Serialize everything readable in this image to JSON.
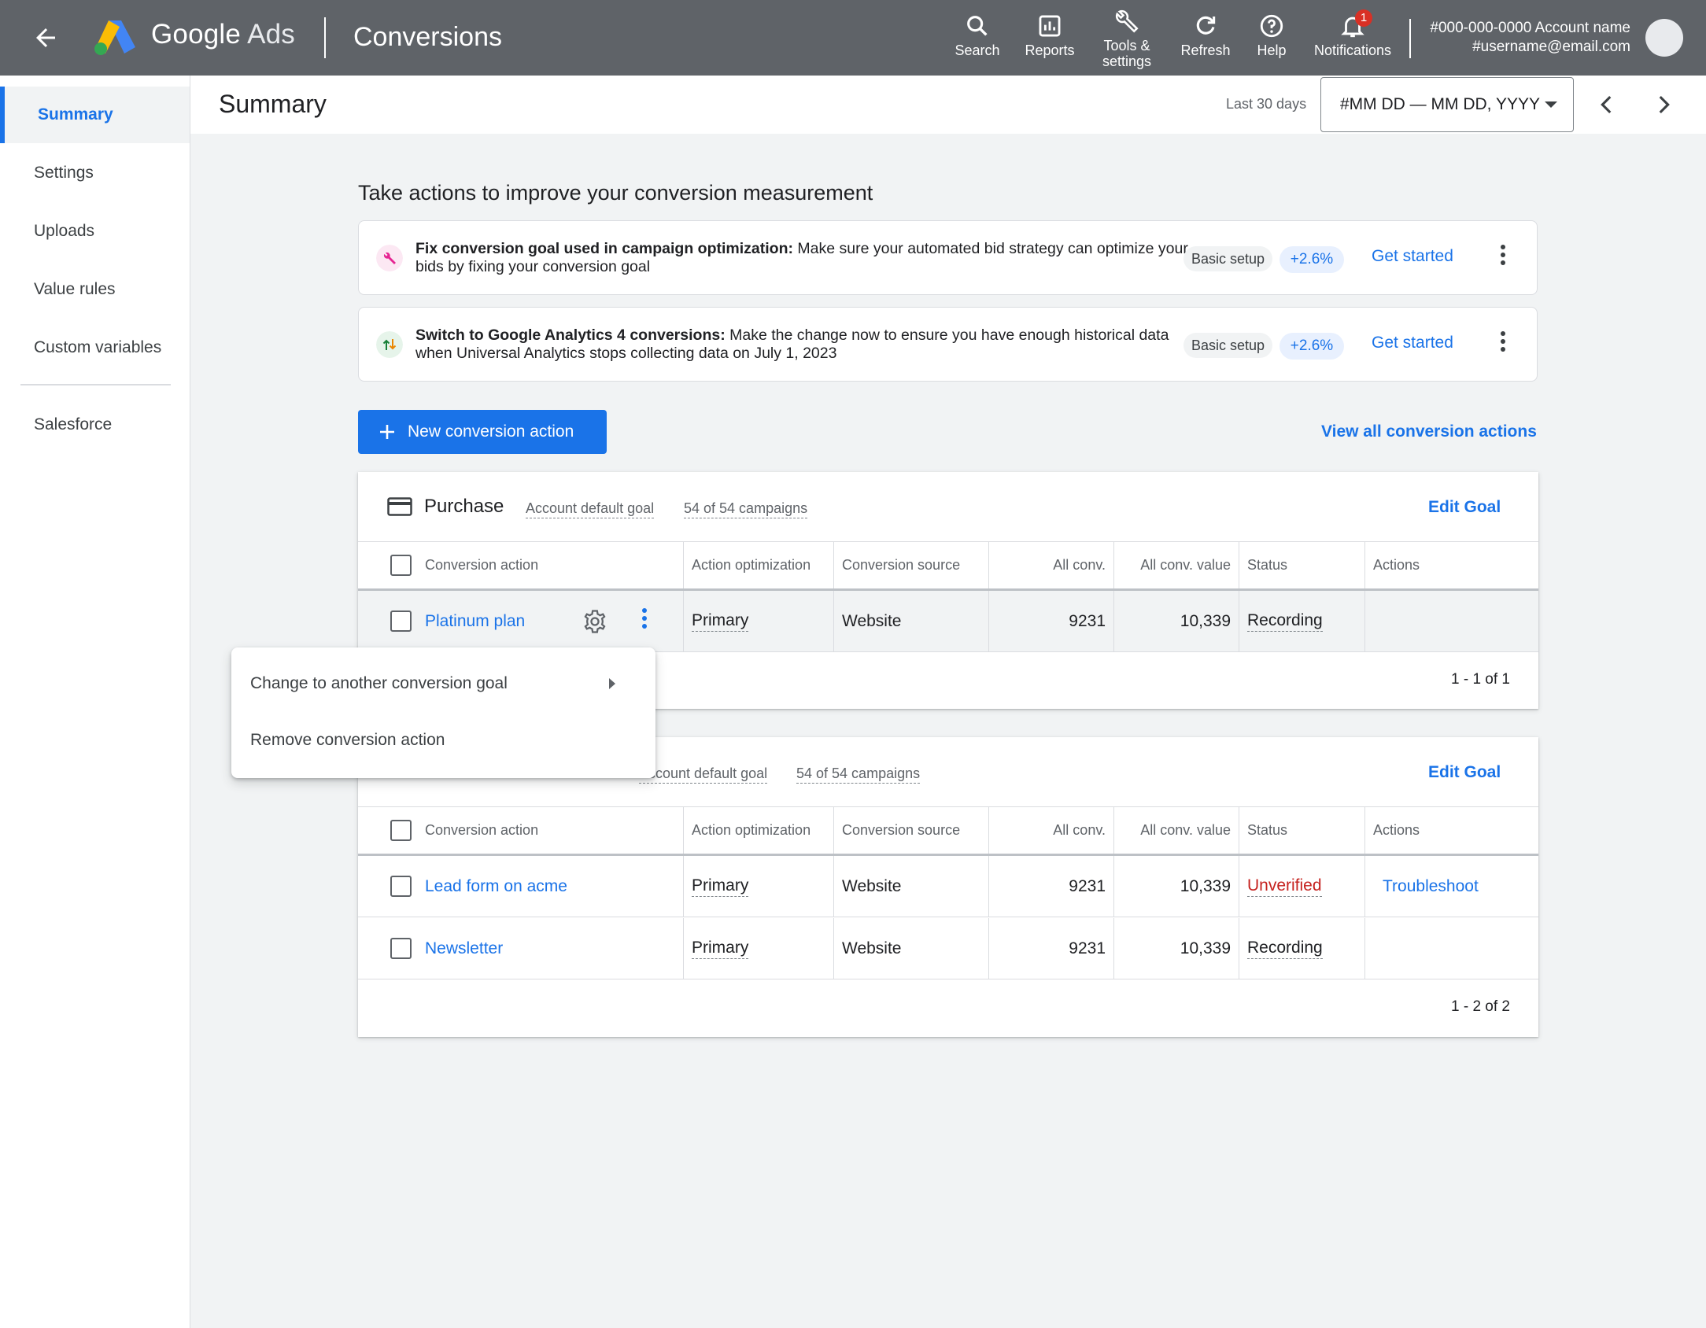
{
  "topbar": {
    "brand_google": "Google",
    "brand_ads": "Ads",
    "section": "Conversions",
    "items": [
      {
        "label": "Search",
        "icon": "search-icon"
      },
      {
        "label": "Reports",
        "icon": "reports-icon"
      },
      {
        "label": "Tools &",
        "label2": "settings",
        "icon": "wrench-icon"
      },
      {
        "label": "Refresh",
        "icon": "refresh-icon"
      },
      {
        "label": "Help",
        "icon": "help-icon"
      },
      {
        "label": "Notifications",
        "icon": "bell-icon",
        "badge": "1"
      }
    ],
    "account_line1": "#000-000-0000 Account name",
    "account_line2": "#username@email.com"
  },
  "sidebar": {
    "items": [
      {
        "label": "Summary",
        "active": true
      },
      {
        "label": "Settings"
      },
      {
        "label": "Uploads"
      },
      {
        "label": "Value rules"
      },
      {
        "label": "Custom variables"
      },
      {
        "label": "Salesforce"
      }
    ]
  },
  "subheader": {
    "title": "Summary",
    "range_label": "Last 30 days",
    "date_range": "#MM DD — MM DD, YYYY"
  },
  "recommendations": {
    "title": "Take actions to improve your conversion measurement",
    "cards": [
      {
        "bold": "Fix conversion goal used in campaign optimization:",
        "text": " Make sure your automated bid strategy can optimize your bids by fixing your conversion goal",
        "chip": "Basic setup",
        "uplift": "+2.6%",
        "cta": "Get started",
        "icon": "wrench-icon"
      },
      {
        "bold": "Switch to Google Analytics 4 conversions:",
        "text": " Make the change now to ensure you have enough historical data when Universal Analytics stops collecting data on July 1, 2023",
        "chip": "Basic setup",
        "uplift": "+2.6%",
        "cta": "Get started",
        "icon": "swap-arrows-icon"
      }
    ]
  },
  "new_button": "New conversion action",
  "view_all": "View all conversion actions",
  "columns": [
    "Conversion action",
    "Action optimization",
    "Conversion source",
    "All conv.",
    "All conv. value",
    "Status",
    "Actions"
  ],
  "goals": [
    {
      "name": "Purchase",
      "meta1": "Account default goal",
      "meta2": "54 of 54 campaigns",
      "edit": "Edit Goal",
      "rows": [
        {
          "action": "Platinum plan",
          "optimization": "Primary",
          "source": "Website",
          "all_conv": "9231",
          "all_value": "10,339",
          "status": "Recording",
          "actions": ""
        }
      ],
      "pager": "1 - 1 of 1"
    },
    {
      "name": "",
      "meta1": "Account default goal",
      "meta2": "54 of 54 campaigns",
      "edit": "Edit Goal",
      "rows": [
        {
          "action": "Lead form on acme",
          "optimization": "Primary",
          "source": "Website",
          "all_conv": "9231",
          "all_value": "10,339",
          "status": "Unverified",
          "actions": "Troubleshoot"
        },
        {
          "action": "Newsletter",
          "optimization": "Primary",
          "source": "Website",
          "all_conv": "9231",
          "all_value": "10,339",
          "status": "Recording",
          "actions": ""
        }
      ],
      "pager": "1 - 2 of 2"
    }
  ],
  "menu": {
    "items": [
      "Change to another conversion goal",
      "Remove conversion action"
    ]
  },
  "colors": {
    "topbar": "#5f6368",
    "accent": "#1a73e8",
    "error": "#c5221f"
  }
}
